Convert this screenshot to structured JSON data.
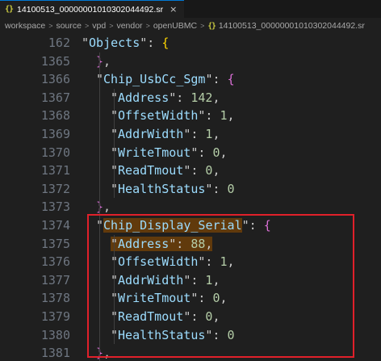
{
  "tab": {
    "icon": "{}",
    "label": "14100513_00000001010302044492.sr",
    "close": "×"
  },
  "breadcrumb": {
    "items": [
      "workspace",
      "source",
      "vpd",
      "vendor",
      "openUBMC"
    ],
    "file_icon": "{}",
    "file": "14100513_00000001010302044492.sr"
  },
  "editor": {
    "lines": [
      {
        "n": "162",
        "segs": [
          [
            "p",
            "\""
          ],
          [
            "k",
            "Objects"
          ],
          [
            "p",
            "\": "
          ],
          [
            "b",
            "{"
          ]
        ],
        "indent": 0
      },
      {
        "n": "1365",
        "segs": [
          [
            "c",
            "}"
          ],
          [
            "p",
            ","
          ]
        ],
        "indent": 1
      },
      {
        "n": "1366",
        "segs": [
          [
            "p",
            "\""
          ],
          [
            "k",
            "Chip_UsbCc_Sgm"
          ],
          [
            "p",
            "\": "
          ],
          [
            "c",
            "{"
          ]
        ],
        "indent": 1
      },
      {
        "n": "1367",
        "segs": [
          [
            "p",
            "\""
          ],
          [
            "k",
            "Address"
          ],
          [
            "p",
            "\": "
          ],
          [
            "n",
            "142"
          ],
          [
            "p",
            ","
          ]
        ],
        "indent": 2
      },
      {
        "n": "1368",
        "segs": [
          [
            "p",
            "\""
          ],
          [
            "k",
            "OffsetWidth"
          ],
          [
            "p",
            "\": "
          ],
          [
            "n",
            "1"
          ],
          [
            "p",
            ","
          ]
        ],
        "indent": 2
      },
      {
        "n": "1369",
        "segs": [
          [
            "p",
            "\""
          ],
          [
            "k",
            "AddrWidth"
          ],
          [
            "p",
            "\": "
          ],
          [
            "n",
            "1"
          ],
          [
            "p",
            ","
          ]
        ],
        "indent": 2
      },
      {
        "n": "1370",
        "segs": [
          [
            "p",
            "\""
          ],
          [
            "k",
            "WriteTmout"
          ],
          [
            "p",
            "\": "
          ],
          [
            "n",
            "0"
          ],
          [
            "p",
            ","
          ]
        ],
        "indent": 2
      },
      {
        "n": "1371",
        "segs": [
          [
            "p",
            "\""
          ],
          [
            "k",
            "ReadTmout"
          ],
          [
            "p",
            "\": "
          ],
          [
            "n",
            "0"
          ],
          [
            "p",
            ","
          ]
        ],
        "indent": 2
      },
      {
        "n": "1372",
        "segs": [
          [
            "p",
            "\""
          ],
          [
            "k",
            "HealthStatus"
          ],
          [
            "p",
            "\": "
          ],
          [
            "n",
            "0"
          ]
        ],
        "indent": 2
      },
      {
        "n": "1373",
        "segs": [
          [
            "c",
            "}"
          ],
          [
            "p",
            ","
          ]
        ],
        "indent": 1
      },
      {
        "n": "1374",
        "segs": [
          [
            "p",
            "\""
          ],
          [
            "k",
            "Chip_Display_Serial",
            true
          ],
          [
            "p",
            "\": "
          ],
          [
            "c",
            "{"
          ]
        ],
        "indent": 1
      },
      {
        "n": "1375",
        "segs": [
          [
            "p",
            "\"",
            true
          ],
          [
            "k",
            "Address",
            true
          ],
          [
            "p",
            "\": ",
            true
          ],
          [
            "n",
            "88",
            true
          ],
          [
            "p",
            ",",
            true
          ]
        ],
        "indent": 2
      },
      {
        "n": "1376",
        "segs": [
          [
            "p",
            "\""
          ],
          [
            "k",
            "OffsetWidth"
          ],
          [
            "p",
            "\": "
          ],
          [
            "n",
            "1"
          ],
          [
            "p",
            ","
          ]
        ],
        "indent": 2
      },
      {
        "n": "1377",
        "segs": [
          [
            "p",
            "\""
          ],
          [
            "k",
            "AddrWidth"
          ],
          [
            "p",
            "\": "
          ],
          [
            "n",
            "1"
          ],
          [
            "p",
            ","
          ]
        ],
        "indent": 2
      },
      {
        "n": "1378",
        "segs": [
          [
            "p",
            "\""
          ],
          [
            "k",
            "WriteTmout"
          ],
          [
            "p",
            "\": "
          ],
          [
            "n",
            "0"
          ],
          [
            "p",
            ","
          ]
        ],
        "indent": 2
      },
      {
        "n": "1379",
        "segs": [
          [
            "p",
            "\""
          ],
          [
            "k",
            "ReadTmout"
          ],
          [
            "p",
            "\": "
          ],
          [
            "n",
            "0"
          ],
          [
            "p",
            ","
          ]
        ],
        "indent": 2
      },
      {
        "n": "1380",
        "segs": [
          [
            "p",
            "\""
          ],
          [
            "k",
            "HealthStatus"
          ],
          [
            "p",
            "\": "
          ],
          [
            "n",
            "0"
          ]
        ],
        "indent": 2
      },
      {
        "n": "1381",
        "segs": [
          [
            "c",
            "}"
          ],
          [
            "p",
            ","
          ]
        ],
        "indent": 1
      }
    ]
  },
  "colors": {
    "background": "#1f1f1f",
    "key": "#9cdcfe",
    "number": "#b5cea8",
    "brace_outer": "#ffd700",
    "brace_inner": "#da70d6",
    "highlight": "#613a0c",
    "annotation_box": "#e0202a"
  }
}
